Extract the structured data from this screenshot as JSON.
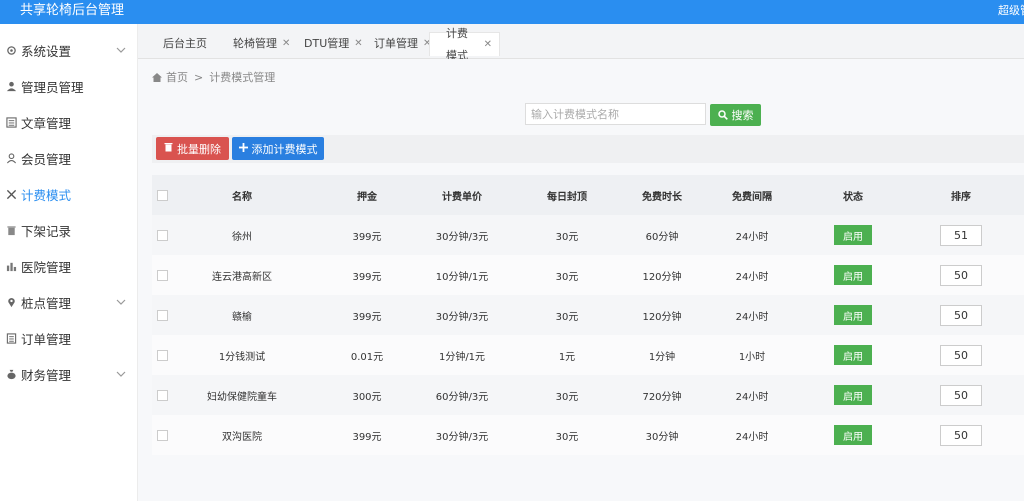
{
  "app": {
    "title": "共享轮椅后台管理",
    "user": "超级管理员"
  },
  "sidebar": {
    "items": [
      {
        "label": "系统设置",
        "icon": "gear-icon",
        "expandable": true
      },
      {
        "label": "管理员管理",
        "icon": "user-icon",
        "expandable": false
      },
      {
        "label": "文章管理",
        "icon": "article-icon",
        "expandable": false
      },
      {
        "label": "会员管理",
        "icon": "member-icon",
        "expandable": false
      },
      {
        "label": "计费模式",
        "icon": "wrench-icon",
        "expandable": false,
        "active": true
      },
      {
        "label": "下架记录",
        "icon": "trash-icon",
        "expandable": false
      },
      {
        "label": "医院管理",
        "icon": "chart-icon",
        "expandable": false
      },
      {
        "label": "桩点管理",
        "icon": "pin-icon",
        "expandable": true
      },
      {
        "label": "订单管理",
        "icon": "list-icon",
        "expandable": false
      },
      {
        "label": "财务管理",
        "icon": "money-icon",
        "expandable": true
      }
    ]
  },
  "tabs": [
    {
      "label": "后台主页",
      "closable": false
    },
    {
      "label": "轮椅管理",
      "closable": true
    },
    {
      "label": "DTU管理",
      "closable": true
    },
    {
      "label": "订单管理",
      "closable": true
    },
    {
      "label": "计费模式",
      "closable": true,
      "active": true
    }
  ],
  "breadcrumb": {
    "home": "首页",
    "separator": ">",
    "current": "计费模式管理"
  },
  "search": {
    "placeholder": "输入计费模式名称",
    "value": "",
    "button": "搜索"
  },
  "toolbar": {
    "batch_delete": "批量删除",
    "add": "添加计费模式"
  },
  "table": {
    "columns": [
      "名称",
      "押金",
      "计费单价",
      "每日封顶",
      "免费时长",
      "免费间隔",
      "状态",
      "排序"
    ],
    "rows": [
      {
        "name": "徐州",
        "deposit": "399元",
        "price": "30分钟/3元",
        "cap": "30元",
        "free": "60分钟",
        "interval": "24小时",
        "status": "启用",
        "sort": "51"
      },
      {
        "name": "连云港高新区",
        "deposit": "399元",
        "price": "10分钟/1元",
        "cap": "30元",
        "free": "120分钟",
        "interval": "24小时",
        "status": "启用",
        "sort": "50"
      },
      {
        "name": "赣榆",
        "deposit": "399元",
        "price": "30分钟/3元",
        "cap": "30元",
        "free": "120分钟",
        "interval": "24小时",
        "status": "启用",
        "sort": "50"
      },
      {
        "name": "1分钱测试",
        "deposit": "0.01元",
        "price": "1分钟/1元",
        "cap": "1元",
        "free": "1分钟",
        "interval": "1小时",
        "status": "启用",
        "sort": "50"
      },
      {
        "name": "妇幼保健院童车",
        "deposit": "300元",
        "price": "60分钟/3元",
        "cap": "30元",
        "free": "720分钟",
        "interval": "24小时",
        "status": "启用",
        "sort": "50"
      },
      {
        "name": "双沟医院",
        "deposit": "399元",
        "price": "30分钟/3元",
        "cap": "30元",
        "free": "30分钟",
        "interval": "24小时",
        "status": "启用",
        "sort": "50"
      }
    ]
  },
  "colors": {
    "primary": "#2a8ef0",
    "success": "#4cb050",
    "danger": "#d9534f",
    "add": "#2a7fe0"
  }
}
